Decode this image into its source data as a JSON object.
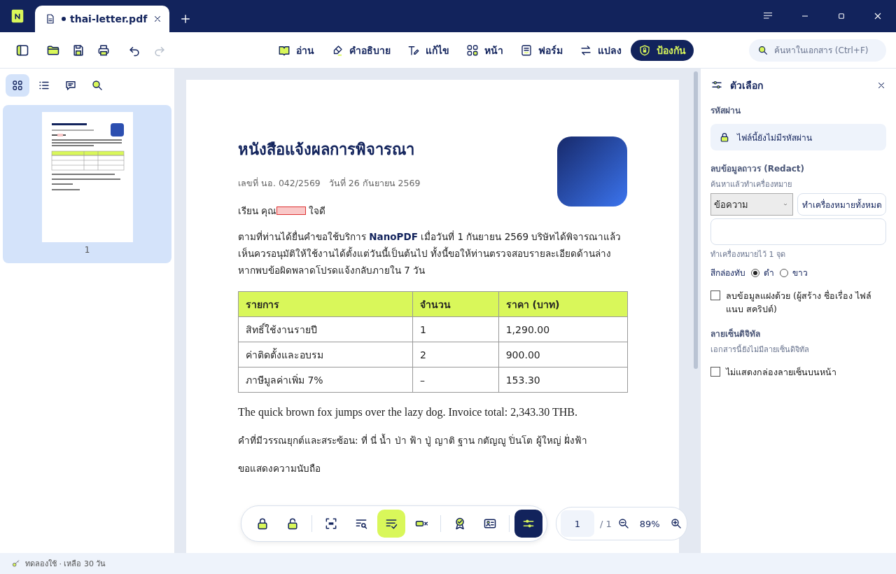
{
  "tab": {
    "title": "thai-letter.pdf",
    "modified": true
  },
  "toolbar": {
    "redo_disabled": true,
    "modes": [
      {
        "kind": "read",
        "label": "อ่าน",
        "selected": false
      },
      {
        "kind": "comment",
        "label": "คำอธิบาย",
        "selected": false
      },
      {
        "kind": "edit",
        "label": "แก้ไข",
        "selected": false
      },
      {
        "kind": "page",
        "label": "หน้า",
        "selected": false
      },
      {
        "kind": "form",
        "label": "ฟอร์ม",
        "selected": false
      },
      {
        "kind": "convert",
        "label": "แปลง",
        "selected": false
      },
      {
        "kind": "protect",
        "label": "ป้องกัน",
        "selected": true
      }
    ],
    "search": {
      "placeholder": "ค้นหาในเอกสาร (Ctrl+F)"
    }
  },
  "sidebar": {
    "views": [
      {
        "kind": "grid",
        "selected": true
      },
      {
        "kind": "list",
        "selected": false
      },
      {
        "kind": "comments",
        "selected": false
      },
      {
        "kind": "search",
        "selected": false
      }
    ],
    "pages": [
      {
        "number": "1",
        "selected": true
      }
    ]
  },
  "document": {
    "title": "หนังสือแจ้งผลการพิจารณา",
    "meta": "เลขที่ นอ. 042/2569   วันที่ 26 กันยายน 2569",
    "greeting": "เรียน คุณ",
    "greeting_name": "ใจดี",
    "body": "ตามที่ท่านได้ยื่นคำขอใช้บริการ **NanoPDF** เมื่อวันที่ 1 กันยายน 2569 บริษัทได้พิจารณาแล้ว เห็นควรอนุมัติให้ใช้งานได้ตั้งแต่วันนี้เป็นต้นไป ทั้งนี้ขอให้ท่านตรวจสอบรายละเอียดด้านล่าง หากพบข้อผิดพลาดโปรดแจ้งกลับภายใน 7 วัน",
    "table": {
      "columns": [
        "รายการ",
        "จำนวน",
        "ราคา (บาท)"
      ],
      "rows": [
        [
          "สิทธิ์ใช้งานรายปี",
          "1",
          "1,290.00"
        ],
        [
          "ค่าติดตั้งและอบรม",
          "2",
          "900.00"
        ],
        [
          "ภาษีมูลค่าเพิ่ม 7%",
          "–",
          "153.30"
        ]
      ]
    },
    "paragraphs": [
      {
        "kind": "serif",
        "text": "The quick brown fox jumps over the lazy dog. Invoice total: 2,343.30 THB."
      },
      {
        "kind": "plain",
        "text": "คำที่มีวรรณยุกต์และสระซ้อน: ที่ นี่ น้ำ ป่า ฟ้า ปู่ ญาติ ฐาน กตัญญู ปิ่นโต ผู้ใหญ่ ฝั่งฟ้า"
      },
      {
        "kind": "plain",
        "text": "ขอแสดงความนับถือ"
      }
    ]
  },
  "bottom_toolbar": {
    "tool_groups": [
      [
        {
          "kind": "lock",
          "selected": false,
          "on": false
        },
        {
          "kind": "unlock",
          "selected": false,
          "on": false
        }
      ],
      [
        {
          "kind": "area",
          "selected": false,
          "on": false
        },
        {
          "kind": "find",
          "selected": false,
          "on": false
        },
        {
          "kind": "apply",
          "selected": true,
          "on": false
        },
        {
          "kind": "remove",
          "selected": false,
          "on": false
        }
      ],
      [
        {
          "kind": "award",
          "selected": false,
          "on": false
        },
        {
          "kind": "idcard",
          "selected": false,
          "on": false
        }
      ],
      [
        {
          "kind": "sliders",
          "selected": false,
          "on": true
        }
      ]
    ]
  },
  "page_nav": {
    "page": "1",
    "total": "/ 1",
    "zoom": "89%"
  },
  "options_panel": {
    "title": "ตัวเลือก",
    "password": {
      "label": "รหัสผ่าน",
      "status": "ไฟล์นี้ยังไม่มีรหัสผ่าน"
    },
    "redact": {
      "label": "ลบข้อมูลถาวร (Redact)",
      "hint": "ค้นหาแล้วทำเครื่องหมาย",
      "mode": "ข้อความ",
      "mark_all": "ทำเครื่องหมายทั้งหมด",
      "count": "ทำเครื่องหมายไว้ 1 จุด",
      "color_label": "สีกล่องทับ",
      "colors": [
        {
          "label": "ดำ",
          "selected": true
        },
        {
          "label": "ขาว",
          "selected": false
        }
      ],
      "metadata": {
        "label": "ลบข้อมูลแฝงด้วย (ผู้สร้าง ชื่อเรื่อง ไฟล์แนบ สคริปต์)",
        "checked": false
      }
    },
    "signature": {
      "label": "ลายเซ็นดิจิทัล",
      "status": "เอกสารนี้ยังไม่มีลายเซ็นดิจิทัล",
      "hide_box": {
        "label": "ไม่แสดงกล่องลายเซ็นบนหน้า",
        "checked": false
      }
    }
  },
  "status_bar": {
    "text": "ทดลองใช้ · เหลือ 30 วัน"
  }
}
